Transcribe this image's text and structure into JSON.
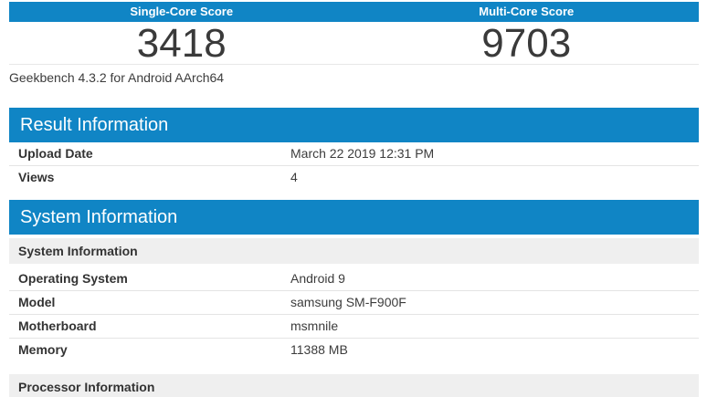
{
  "theme": {
    "accent_blue": "#1085C5",
    "subheader_bg": "#efefef",
    "row_border": "#e4e4e4",
    "text": "#333333"
  },
  "scoreboard": {
    "columns": [
      {
        "label": "Single-Core Score",
        "score": "3418"
      },
      {
        "label": "Multi-Core Score",
        "score": "9703"
      }
    ],
    "caption": "Geekbench 4.3.2 for Android AArch64"
  },
  "sections": [
    {
      "title": "Result Information",
      "rows": [
        {
          "label": "Upload Date",
          "value": "March 22 2019 12:31 PM"
        },
        {
          "label": "Views",
          "value": "4"
        }
      ]
    },
    {
      "title": "System Information",
      "subsections": [
        {
          "header": "System Information",
          "rows": [
            {
              "label": "Operating System",
              "value": "Android 9"
            },
            {
              "label": "Model",
              "value": "samsung SM-F900F"
            },
            {
              "label": "Motherboard",
              "value": "msmnile"
            },
            {
              "label": "Memory",
              "value": "11388 MB"
            }
          ]
        },
        {
          "header": "Processor Information",
          "rows": []
        }
      ]
    }
  ]
}
